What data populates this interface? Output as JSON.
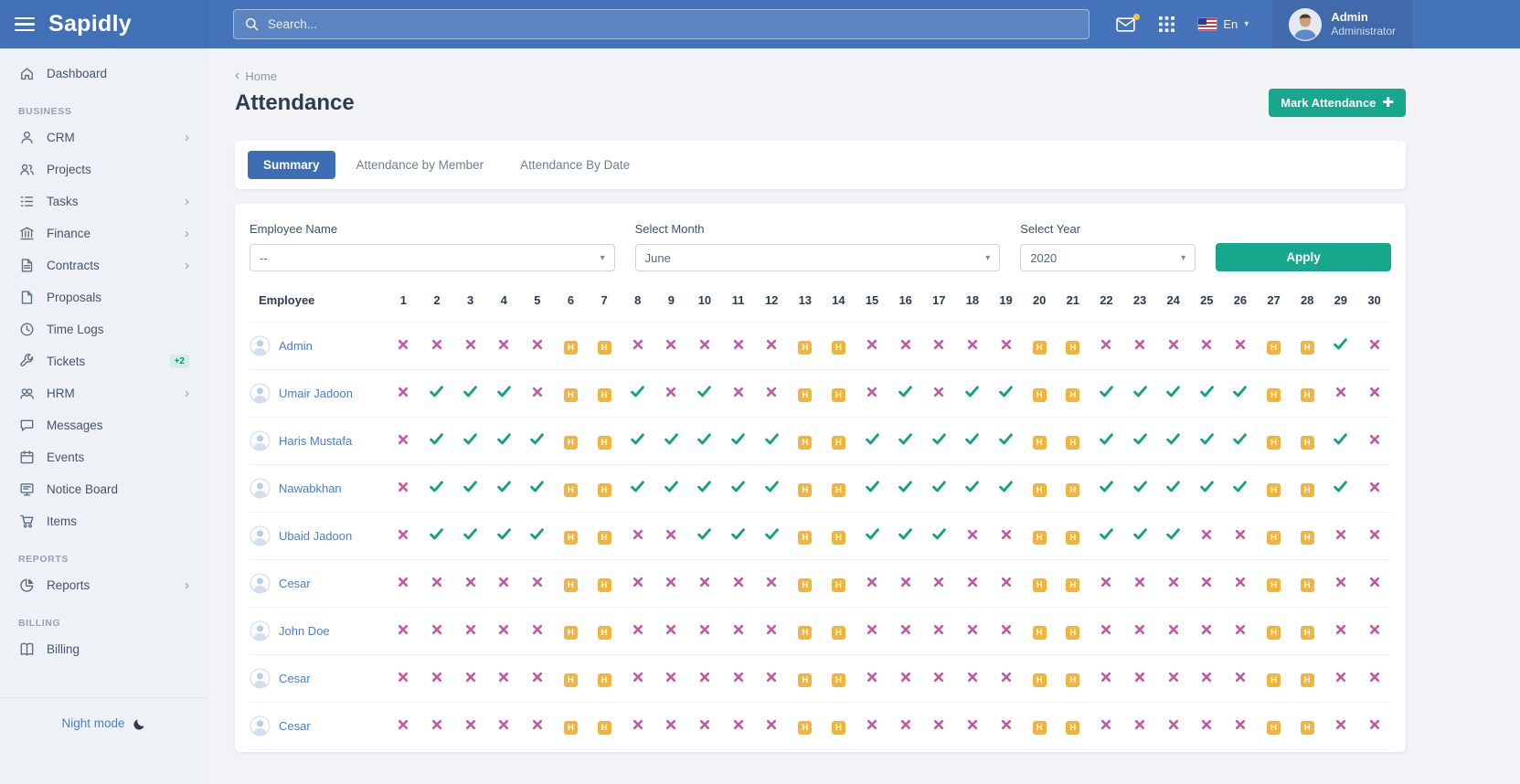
{
  "brand": {
    "name": "Sapidly"
  },
  "topbar": {
    "search_placeholder": "Search...",
    "language": "En",
    "user_name": "Admin",
    "user_role": "Administrator"
  },
  "sidebar": {
    "sections": [
      {
        "title": "",
        "items": [
          {
            "label": "Dashboard",
            "icon": "home-icon"
          }
        ]
      },
      {
        "title": "BUSINESS",
        "items": [
          {
            "label": "CRM",
            "icon": "user-icon",
            "chevron": true
          },
          {
            "label": "Projects",
            "icon": "people-icon"
          },
          {
            "label": "Tasks",
            "icon": "list-icon",
            "chevron": true
          },
          {
            "label": "Finance",
            "icon": "bank-icon",
            "chevron": true
          },
          {
            "label": "Contracts",
            "icon": "file-contract-icon",
            "chevron": true
          },
          {
            "label": "Proposals",
            "icon": "file-icon"
          },
          {
            "label": "Time Logs",
            "icon": "clock-icon"
          },
          {
            "label": "Tickets",
            "icon": "wrench-icon",
            "badge": "+2"
          },
          {
            "label": "HRM",
            "icon": "team-icon",
            "chevron": true
          },
          {
            "label": "Messages",
            "icon": "chat-icon"
          },
          {
            "label": "Events",
            "icon": "calendar-icon"
          },
          {
            "label": "Notice Board",
            "icon": "board-icon"
          },
          {
            "label": "Items",
            "icon": "cart-icon"
          }
        ]
      },
      {
        "title": "REPORTS",
        "items": [
          {
            "label": "Reports",
            "icon": "pie-chart-icon",
            "chevron": true
          }
        ]
      },
      {
        "title": "BILLING",
        "items": [
          {
            "label": "Billing",
            "icon": "book-icon"
          }
        ]
      }
    ],
    "night_mode_label": "Night mode"
  },
  "page": {
    "breadcrumb_home": "Home",
    "title": "Attendance",
    "mark_attendance_label": "Mark Attendance",
    "tabs": [
      {
        "label": "Summary",
        "active": true
      },
      {
        "label": "Attendance by Member",
        "active": false
      },
      {
        "label": "Attendance By Date",
        "active": false
      }
    ]
  },
  "filters": {
    "employee_label": "Employee Name",
    "employee_value": "--",
    "month_label": "Select Month",
    "month_value": "June",
    "year_label": "Select Year",
    "year_value": "2020",
    "apply_label": "Apply"
  },
  "attendance": {
    "employee_header": "Employee",
    "days": [
      1,
      2,
      3,
      4,
      5,
      6,
      7,
      8,
      9,
      10,
      11,
      12,
      13,
      14,
      15,
      16,
      17,
      18,
      19,
      20,
      21,
      22,
      23,
      24,
      25,
      26,
      27,
      28,
      29,
      30
    ],
    "legend": {
      "P": "present check",
      "A": "absent x",
      "H": "holiday"
    },
    "rows": [
      {
        "name": "Admin",
        "marks": "AAAAAHHAAAAAHHAAAAAHHAAAAAHHPA"
      },
      {
        "name": "Umair Jadoon",
        "marks": "APPPAHHPAPAAHHAPAPPHHPPPPPHHAA"
      },
      {
        "name": "Haris Mustafa",
        "marks": "APPPPHHPPPPPHHPPPPPHHPPPPPHHPA"
      },
      {
        "name": "Nawabkhan",
        "marks": "APPPPHHPPPPPHHPPPPPHHPPPPPHHPA"
      },
      {
        "name": "Ubaid Jadoon",
        "marks": "APPPPHHAAPPPHHPPPAAHHPPPAAHHAA"
      },
      {
        "name": "Cesar",
        "marks": "AAAAAHHAAAAAHHAAAAAHHAAAAAHHAA"
      },
      {
        "name": "John Doe",
        "marks": "AAAAAHHAAAAAHHAAAAAHHAAAAAHHAA"
      },
      {
        "name": "Cesar",
        "marks": "AAAAAHHAAAAAHHAAAAAHHAAAAAHHAA"
      },
      {
        "name": "Cesar",
        "marks": "AAAAAHHAAAAAHHAAAAAHHAAAAAHHAA"
      }
    ]
  },
  "colors": {
    "topbar_bg": "#4573b9",
    "brand_bg": "#4170b5",
    "accent_green": "#17a78c",
    "active_tab_blue": "#3d6eb4",
    "present_check": "#17a184",
    "absent_x": "#c05aa3",
    "holiday_badge": "#f1b53e",
    "employee_link": "#4a7ed0"
  }
}
